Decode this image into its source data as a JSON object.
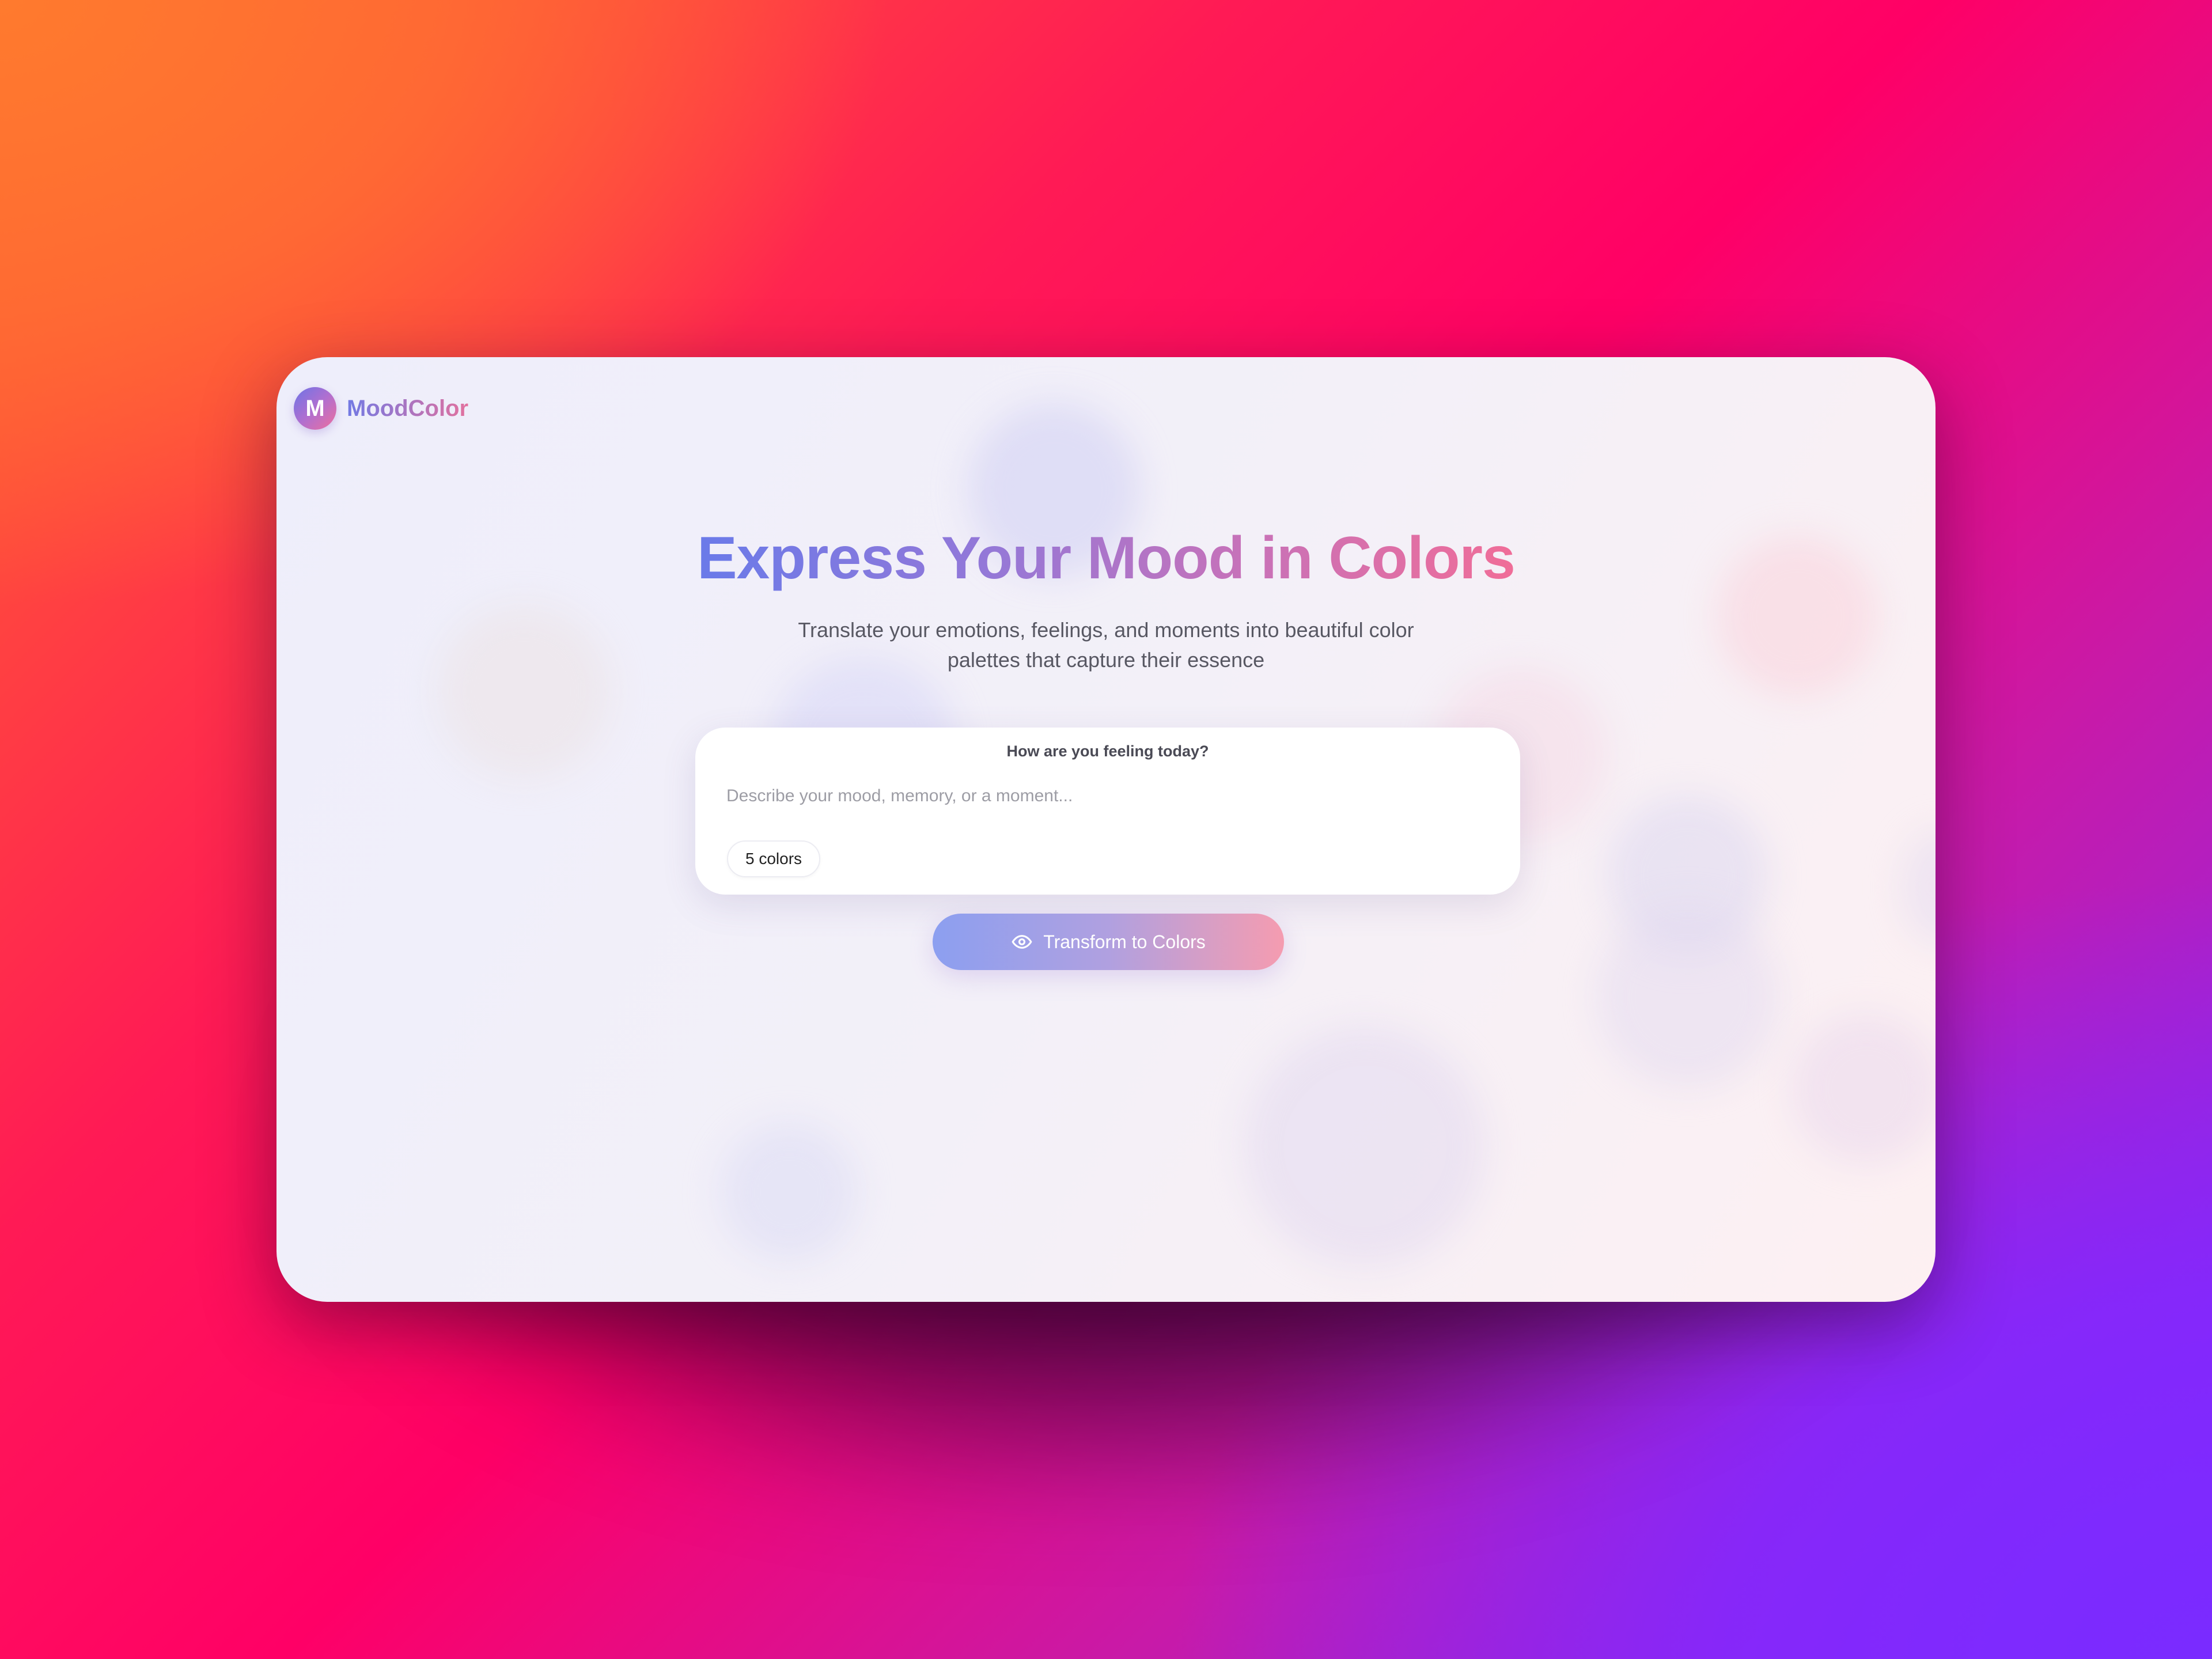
{
  "brand": {
    "logo_letter": "M",
    "name": "MoodColor"
  },
  "hero": {
    "title": "Express Your Mood in Colors",
    "subtitle_line1": "Translate your emotions, feelings, and moments into beautiful color",
    "subtitle_line2": "palettes that capture their essence"
  },
  "input_card": {
    "label": "How are you feeling today?",
    "value": "",
    "placeholder": "Describe your mood, memory, or a moment...",
    "color_count": "5 colors"
  },
  "transform_button": {
    "label": "Transform to Colors",
    "icon": "eye-icon"
  },
  "colors": {
    "accent_start": "#6a7ae9",
    "accent_end": "#f06d98",
    "background_orange": "#ff6b2c",
    "background_pink": "#ff0066",
    "background_purple": "#7d2bff"
  }
}
